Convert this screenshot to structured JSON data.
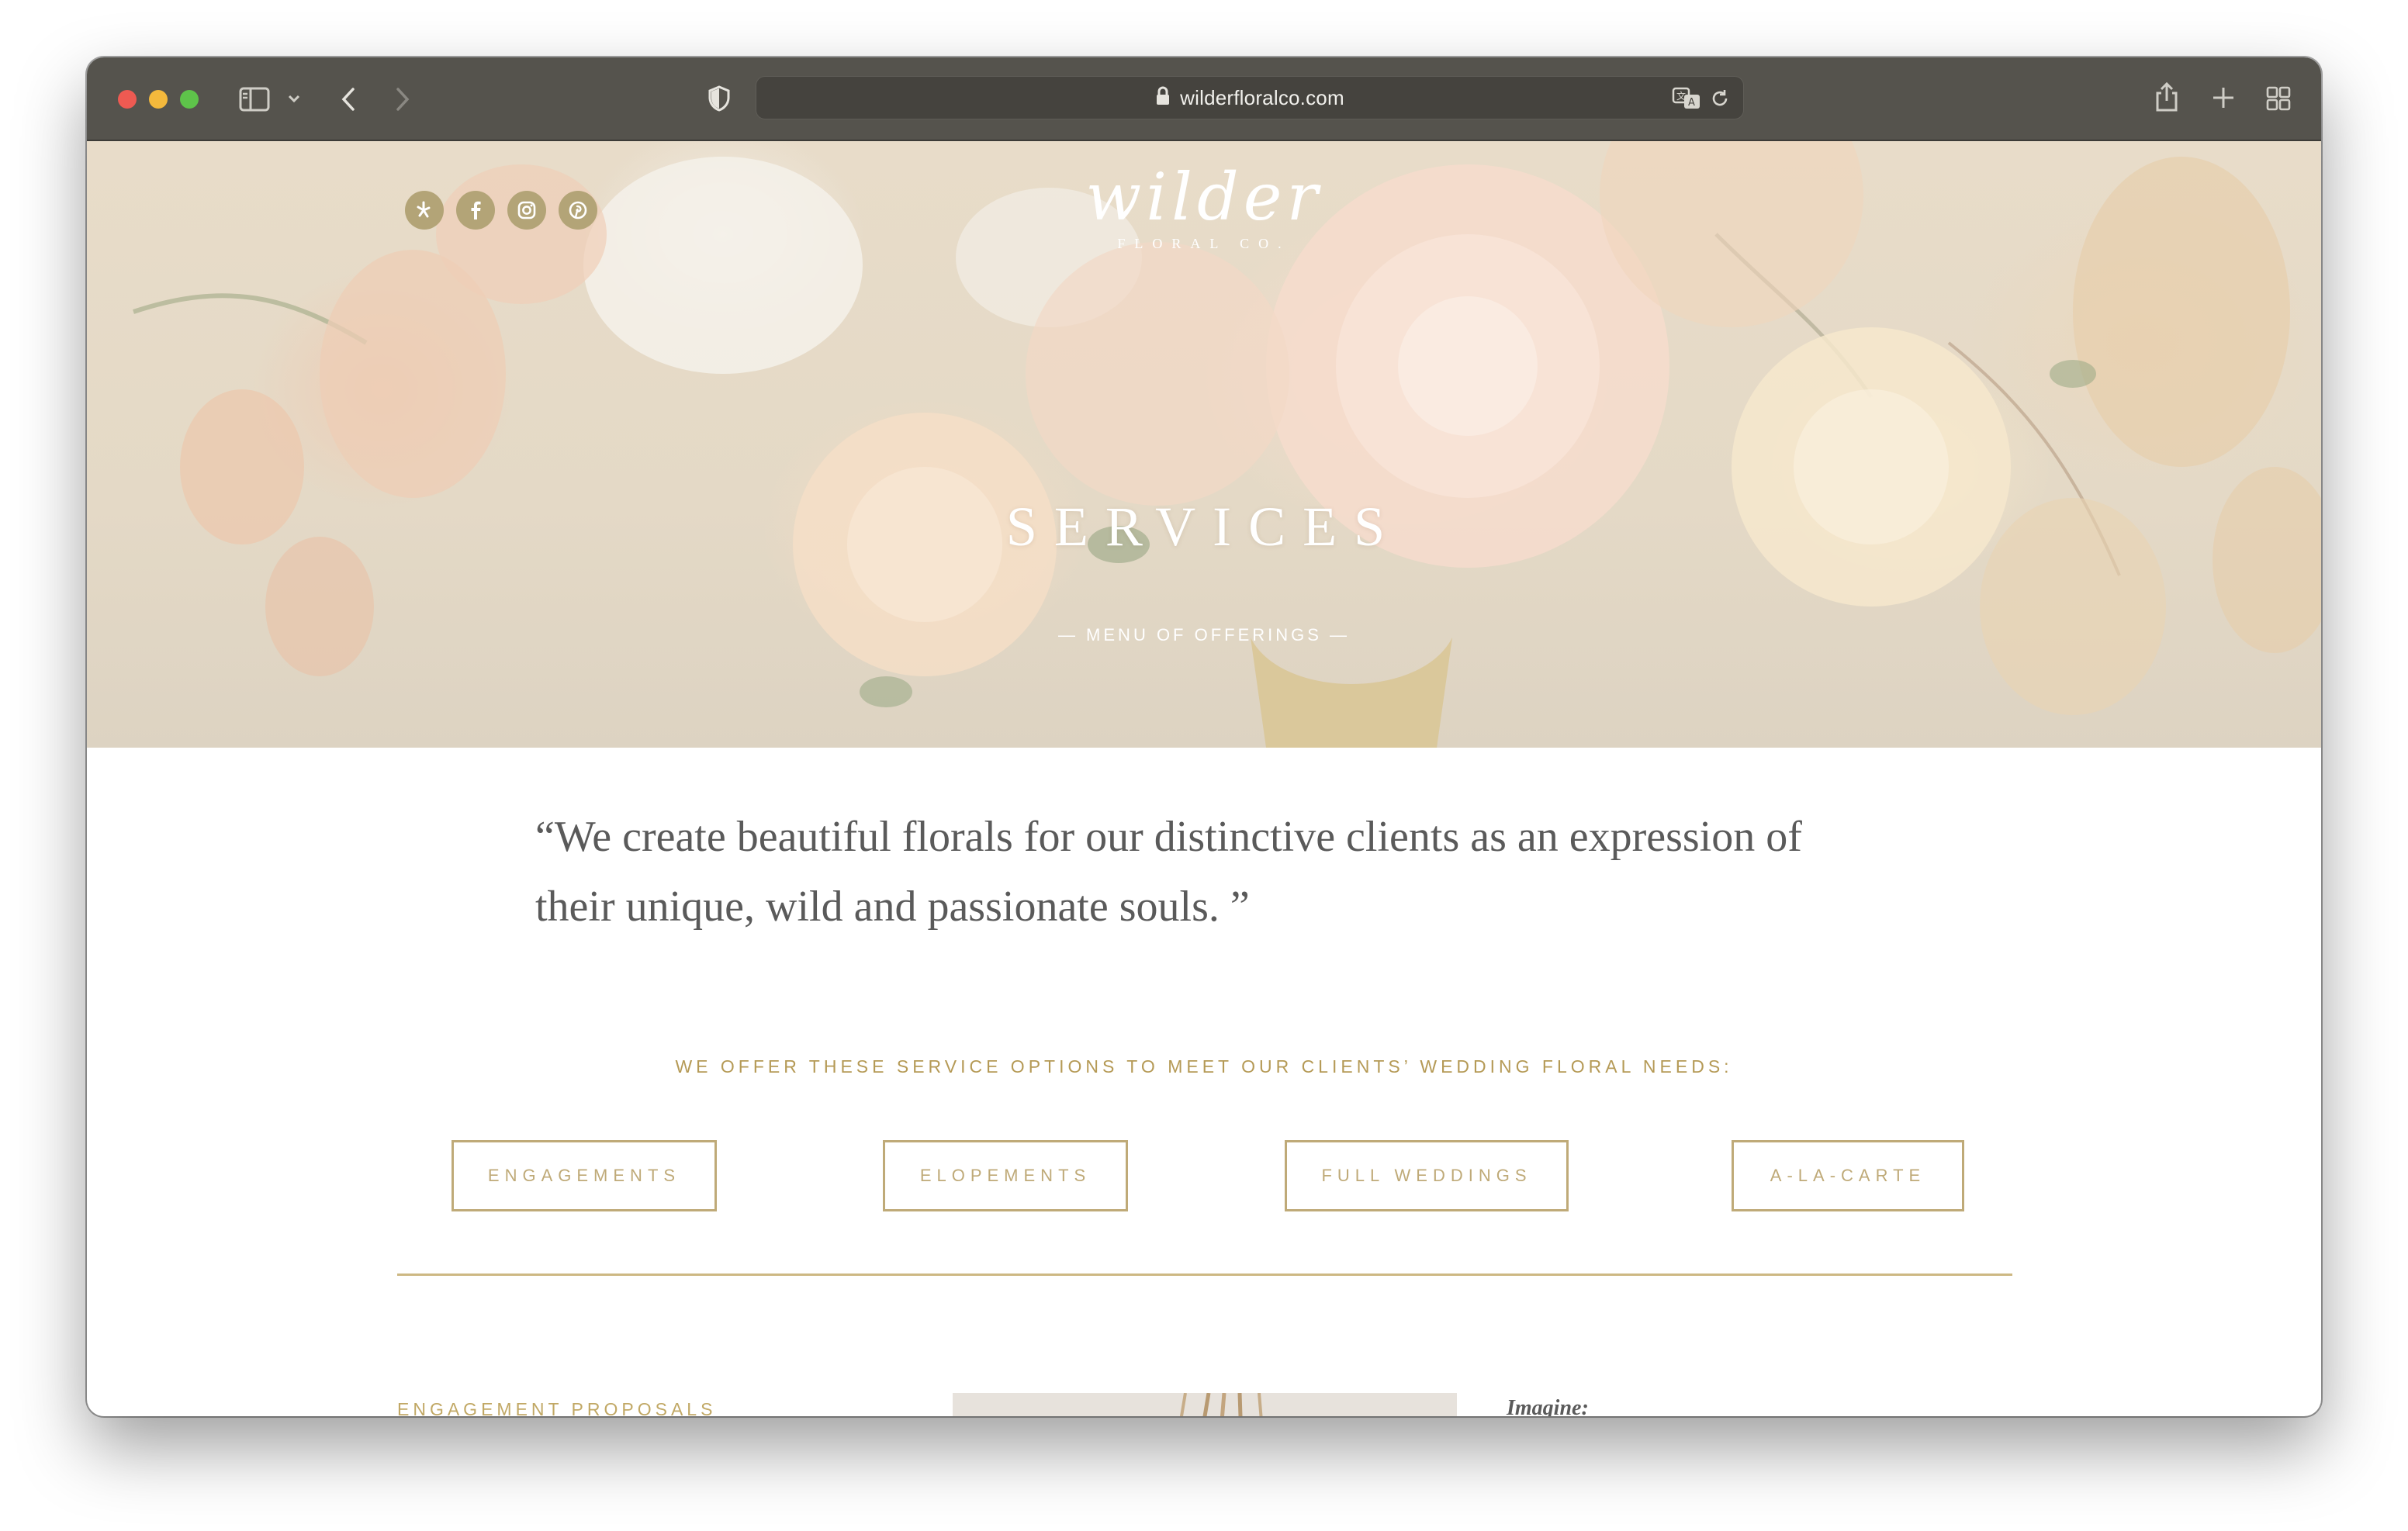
{
  "browser": {
    "url": "wilderfloralco.com",
    "icons": [
      "sidebar-icon",
      "chevron-down-icon",
      "back-icon",
      "forward-icon",
      "shield-icon",
      "lock-icon",
      "translate-icon",
      "reload-icon",
      "share-icon",
      "new-tab-icon",
      "tab-overview-icon"
    ]
  },
  "hero": {
    "social": [
      "yelp-icon",
      "facebook-icon",
      "instagram-icon",
      "pinterest-icon"
    ],
    "logo_script": "wilder",
    "logo_sub": "FLORAL CO.",
    "title": "SERVICES",
    "subtitle": "— MENU OF OFFERINGS —"
  },
  "content": {
    "quote_line1": "“We create beautiful florals for our distinctive clients as an expression of",
    "quote_line2": "their unique, wild and passionate souls. ”",
    "options_heading": "WE OFFER THESE SERVICE OPTIONS TO MEET OUR CLIENTS’ WEDDING FLORAL NEEDS:",
    "buttons": [
      "ENGAGEMENTS",
      "ELOPEMENTS",
      "FULL WEDDINGS",
      "A-LA-CARTE"
    ],
    "engagement_label": "ENGAGEMENT PROPOSALS",
    "imagine_label": "Imagine:"
  },
  "colors": {
    "accent_gold": "#bfaa78",
    "heading_gold": "#b59a56",
    "text_gray": "#5a5a5a",
    "toolbar": "#55534d"
  }
}
